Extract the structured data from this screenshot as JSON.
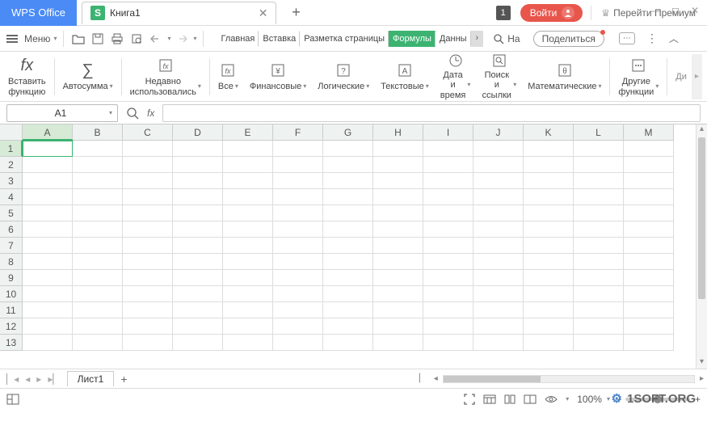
{
  "titlebar": {
    "app_name": "WPS Office",
    "doc_icon_letter": "S",
    "doc_name": "Книга1",
    "help_badge": "1",
    "login_label": "Войти",
    "premium_label": "Перейти Премиум"
  },
  "menubar": {
    "menu_label": "Меню",
    "tabs": [
      "Главная",
      "Вставка",
      "Разметка страницы",
      "Формулы",
      "Данны"
    ],
    "active_tab_index": 3,
    "search_label": "На",
    "share_label": "Поделиться"
  },
  "ribbon": {
    "insert_fn": "Вставить\nфункцию",
    "autosum": "Автосумма",
    "recent": "Недавно\nиспользовались",
    "all": "Все",
    "financial": "Финансовые",
    "logical": "Логические",
    "text": "Текстовые",
    "datetime": "Дата и\nвремя",
    "lookup": "Поиск и\nссылки",
    "math": "Математические",
    "more": "Другие\nфункции",
    "clipped": "Ди"
  },
  "formulabar": {
    "cell_ref": "A1",
    "fx": "fx"
  },
  "grid": {
    "columns": [
      "A",
      "B",
      "C",
      "D",
      "E",
      "F",
      "G",
      "H",
      "I",
      "J",
      "K",
      "L",
      "M"
    ],
    "row_count": 13,
    "selected_col": "A",
    "selected_row": 1
  },
  "sheets": {
    "active_sheet": "Лист1"
  },
  "statusbar": {
    "zoom": "100%"
  },
  "watermark": "1SOFT.ORG"
}
